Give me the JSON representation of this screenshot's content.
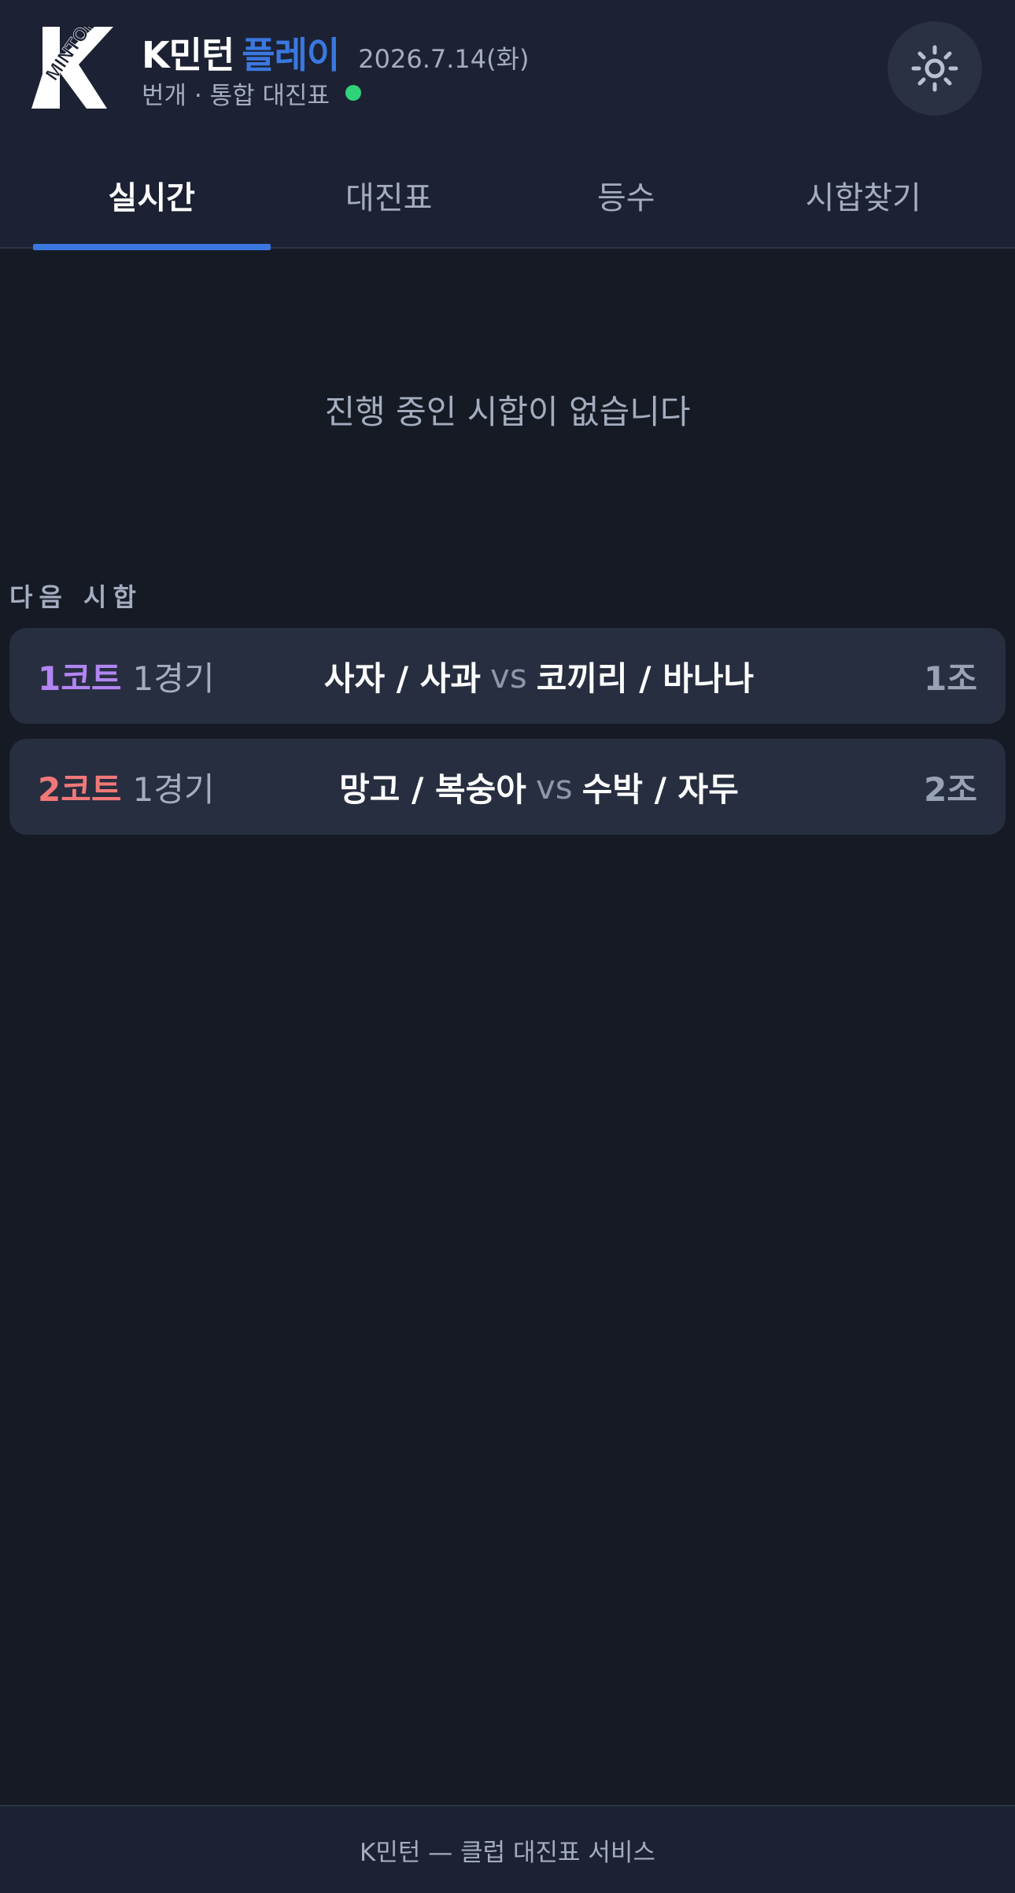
{
  "header": {
    "logo_text": "MINTON",
    "brand_name": "K민턴",
    "brand_accent": "플레이",
    "date": "2026.7.14(화)",
    "subtitle": "번개 · 통합 대진표",
    "status_color": "#2fd37a"
  },
  "tabs": [
    {
      "label": "실시간",
      "active": true
    },
    {
      "label": "대진표",
      "active": false
    },
    {
      "label": "등수",
      "active": false
    },
    {
      "label": "시합찾기",
      "active": false
    }
  ],
  "live": {
    "empty_message": "진행 중인 시합이 없습니다"
  },
  "next_matches": {
    "title": "다음 시합",
    "vs_label": "vs",
    "items": [
      {
        "court": "1코트",
        "court_color": "#b285f2",
        "game": "1경기",
        "team_a": "사자 / 사과",
        "team_b": "코끼리 / 바나나",
        "group": "1조"
      },
      {
        "court": "2코트",
        "court_color": "#f07878",
        "game": "1경기",
        "team_a": "망고 / 복숭아",
        "team_b": "수박 / 자두",
        "group": "2조"
      }
    ]
  },
  "footer": {
    "text": "K민턴 — 클럽 대진표 서비스"
  },
  "colors": {
    "accent": "#3a78e0",
    "background": "#151a24",
    "header": "#1c2233",
    "card": "#272e40"
  },
  "icons": {
    "theme": "sun-icon"
  }
}
